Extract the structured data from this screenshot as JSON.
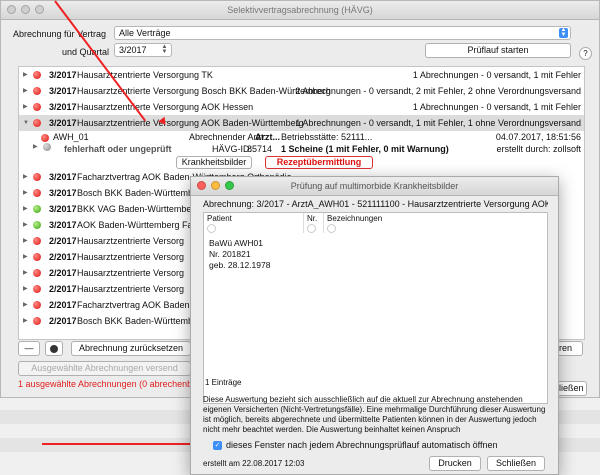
{
  "window": {
    "title": "Selektivvertragsabrechnung (HÄVG)",
    "contract_label": "Abrechnung für Vertrag",
    "contract_value": "Alle Verträge",
    "quarter_label": "und Quartal",
    "quarter_value": "3/2017",
    "start_button": "Prüflauf starten",
    "help": "?"
  },
  "rows": [
    {
      "year": "3/2017",
      "name": "Hausarztzentrierte Versorgung TK",
      "status": "1 Abrechnungen - 0 versandt, 1 mit Fehler",
      "dot": "red"
    },
    {
      "year": "3/2017",
      "name": "Hausarztzentrierte Versorgung Bosch BKK Baden-Württemberg",
      "status": "2 Abrechnungen - 0 versandt, 2 mit Fehler, 2 ohne Verordnungsversand",
      "dot": "red"
    },
    {
      "year": "3/2017",
      "name": "Hausarztzentrierte Versorgung AOK Hessen",
      "status": "1 Abrechnungen - 0 versandt, 1 mit Fehler",
      "dot": "red"
    },
    {
      "year": "3/2017",
      "name": "Hausarztzentrierte Versorgung AOK Baden-Württemberg",
      "status": "1 Abrechnungen - 0 versandt, 1 mit Fehler, 1 ohne Verordnungsversand",
      "dot": "red"
    }
  ],
  "detail": {
    "id": "AWH_01",
    "arzt_label": "Abrechnender Arzt:",
    "arzt_value": "Arzt...",
    "bs_label": "Betriebsstätte: 52111...",
    "havg_label": "HÄVG-ID:",
    "havg_value": "85714",
    "scheine": "1 Scheine (1 mit Fehler, 0 mit Warnung)",
    "date": "04.07.2017, 18:51:56",
    "created": "erstellt durch: zollsoft",
    "sub": "fehlerhaft oder ungeprüft",
    "btn_kranken": "Krankheitsbilder",
    "btn_rezept": "Rezeptübermittlung"
  },
  "rows2": [
    {
      "year": "3/2017",
      "name": "Facharztvertrag AOK Baden-Württemberg Orthopädie",
      "dot": "red"
    },
    {
      "year": "3/2017",
      "name": "Bosch BKK Baden-Württemberg",
      "dot": "red"
    },
    {
      "year": "3/2017",
      "name": "BKK VAG Baden-Württemberg",
      "dot": "green"
    },
    {
      "year": "3/2017",
      "name": "AOK Baden-Württemberg Fac",
      "dot": "green"
    },
    {
      "year": "2/2017",
      "name": "Hausarztzentrierte Versorg",
      "dot": "red"
    },
    {
      "year": "2/2017",
      "name": "Hausarztzentrierte Versorg",
      "dot": "red"
    },
    {
      "year": "2/2017",
      "name": "Hausarztzentrierte Versorg",
      "dot": "red"
    },
    {
      "year": "2/2017",
      "name": "Hausarztzentrierte Versorg",
      "dot": "red"
    },
    {
      "year": "2/2017",
      "name": "Facharztvertrag AOK Baden",
      "dot": "red"
    },
    {
      "year": "2/2017",
      "name": "Bosch BKK Baden-Württemb",
      "dot": "red"
    }
  ],
  "footer": {
    "minus": "—",
    "reset": "Abrechnung zurücksetzen",
    "send": "Ausgewählte Abrechnungen versend",
    "note": "1 ausgewählte Abrechnungen (0 abrechenba",
    "right_partial": "ren",
    "close_partial": "ließen"
  },
  "dialog": {
    "title": "Prüfung auf multimorbide Krankheitsbilder",
    "subtitle": "Abrechnung: 3/2017 - ArztA_AWH01 - 521111100 - Hausarztzentrierte Versorgung AOK I",
    "col_patient": "Patient",
    "col_nr": "Nr.",
    "col_bez": "Bezeichnungen",
    "patient_name": "BaWü AWH01",
    "patient_nr": "Nr. 201821",
    "patient_geb": "geb. 28.12.1978",
    "count": "1 Einträge",
    "description": "Diese Auswertung bezieht sich ausschließlich auf die aktuell zur Abrechnung anstehenden eigenen Versicherten (Nicht-Vertretungsfälle). Eine mehrmalige Durchführung dieser Auswertung ist möglich, bereits abgerechnete und übermittelte Patienten können in der Auswertung jedoch nicht mehr beachtet werden. Die Auswertung beinhaltet keinen Anspruch",
    "checkbox_label": "dieses Fenster nach jedem Abrechnungsprüflauf automatisch öffnen",
    "created": "erstellt am 22.08.2017 12:03",
    "print": "Drucken",
    "close": "Schließen"
  }
}
